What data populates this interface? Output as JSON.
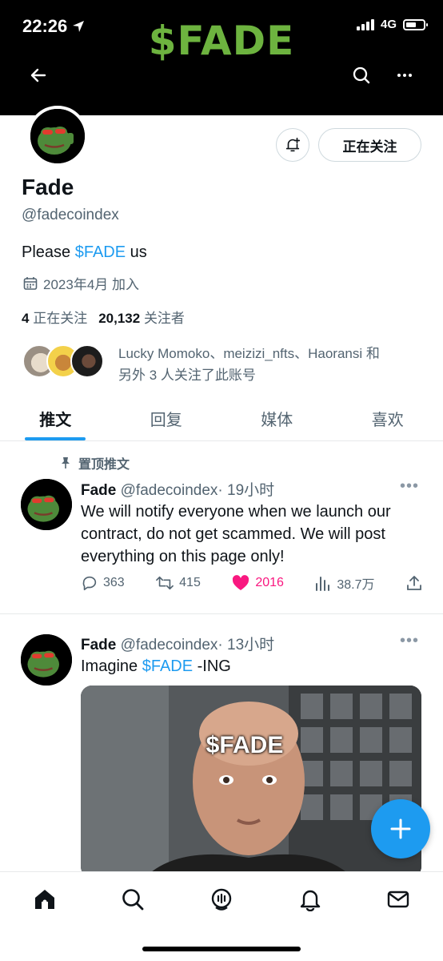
{
  "status_bar": {
    "time": "22:26",
    "network": "4G"
  },
  "header": {
    "brand": "$FADE"
  },
  "profile": {
    "name": "Fade",
    "handle": "@fadecoindex",
    "bio_prefix": "Please ",
    "bio_link": "$FADE",
    "bio_suffix": " us",
    "joined": "2023年4月 加入",
    "following_count": "4",
    "following_label": "正在关注",
    "followers_count": "20,132",
    "followers_label": "关注者",
    "mutuals_line1": "Lucky Momoko、meizizi_nfts、Haoransi 和",
    "mutuals_line2": "另外 3 人关注了此账号",
    "following_button": "正在关注"
  },
  "tabs": [
    {
      "label": "推文",
      "active": true
    },
    {
      "label": "回复",
      "active": false
    },
    {
      "label": "媒体",
      "active": false
    },
    {
      "label": "喜欢",
      "active": false
    }
  ],
  "tweets": [
    {
      "pinned_label": "置顶推文",
      "author": "Fade",
      "handle": "@fadecoindex",
      "time": "· 19小时",
      "text": "We will notify everyone when we launch our contract, do not get scammed. We will post everything on this page only!",
      "replies": "363",
      "retweets": "415",
      "likes": "2016",
      "views": "38.7万"
    },
    {
      "author": "Fade",
      "handle": "@fadecoindex",
      "time": "· 13小时",
      "text_prefix": "Imagine ",
      "text_link": "$FADE",
      "text_suffix": " -ING",
      "media_caption": "$FADE"
    }
  ],
  "colors": {
    "accent": "#1d9bf0",
    "like": "#f91880",
    "brand": "#6db33f"
  },
  "icons": {
    "header": [
      "back-arrow-icon",
      "search-icon",
      "more-icon"
    ],
    "bottom_nav": [
      "home-icon",
      "search-icon",
      "spaces-icon",
      "notifications-icon",
      "messages-icon"
    ]
  }
}
